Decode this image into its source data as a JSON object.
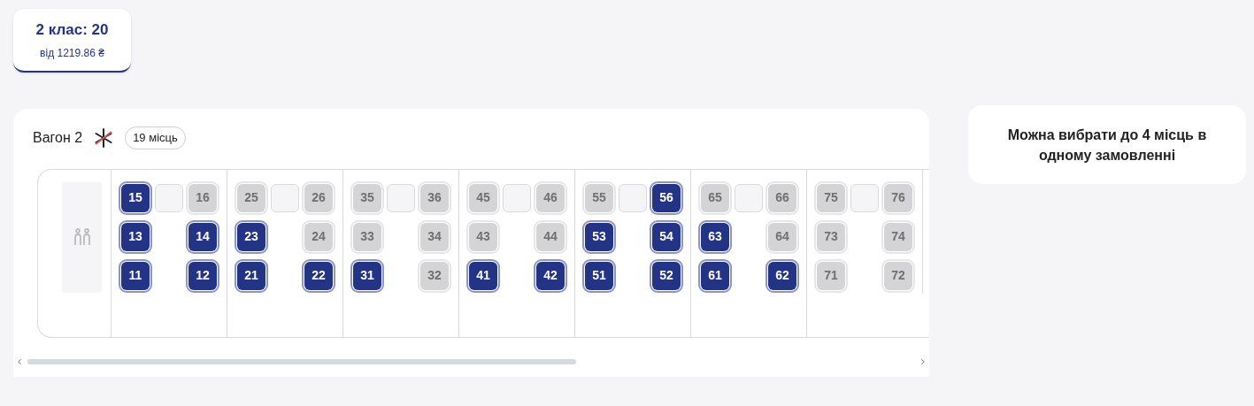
{
  "class_tabs": [
    {
      "title": "2 клас: 20",
      "price": "від 1219.86 ₴",
      "selected": true
    }
  ],
  "wagon": {
    "title": "Вагон 2",
    "seats_badge": "19 місць",
    "compartments": [
      {
        "seats": [
          {
            "number": "15",
            "available": true
          },
          {
            "number": "16",
            "available": false
          },
          {
            "number": "13",
            "available": true
          },
          {
            "number": "14",
            "available": true
          },
          {
            "number": "11",
            "available": true
          },
          {
            "number": "12",
            "available": true
          }
        ]
      },
      {
        "seats": [
          {
            "number": "25",
            "available": false
          },
          {
            "number": "26",
            "available": false
          },
          {
            "number": "23",
            "available": true
          },
          {
            "number": "24",
            "available": false
          },
          {
            "number": "21",
            "available": true
          },
          {
            "number": "22",
            "available": true
          }
        ]
      },
      {
        "seats": [
          {
            "number": "35",
            "available": false
          },
          {
            "number": "36",
            "available": false
          },
          {
            "number": "33",
            "available": false
          },
          {
            "number": "34",
            "available": false
          },
          {
            "number": "31",
            "available": true
          },
          {
            "number": "32",
            "available": false
          }
        ]
      },
      {
        "seats": [
          {
            "number": "45",
            "available": false
          },
          {
            "number": "46",
            "available": false
          },
          {
            "number": "43",
            "available": false
          },
          {
            "number": "44",
            "available": false
          },
          {
            "number": "41",
            "available": true
          },
          {
            "number": "42",
            "available": true
          }
        ]
      },
      {
        "seats": [
          {
            "number": "55",
            "available": false
          },
          {
            "number": "56",
            "available": true
          },
          {
            "number": "53",
            "available": true
          },
          {
            "number": "54",
            "available": true
          },
          {
            "number": "51",
            "available": true
          },
          {
            "number": "52",
            "available": true
          }
        ]
      },
      {
        "seats": [
          {
            "number": "65",
            "available": false
          },
          {
            "number": "66",
            "available": false
          },
          {
            "number": "63",
            "available": true
          },
          {
            "number": "64",
            "available": false
          },
          {
            "number": "61",
            "available": true
          },
          {
            "number": "62",
            "available": true
          }
        ]
      },
      {
        "seats": [
          {
            "number": "75",
            "available": false
          },
          {
            "number": "76",
            "available": false
          },
          {
            "number": "73",
            "available": false
          },
          {
            "number": "74",
            "available": false
          },
          {
            "number": "71",
            "available": false
          },
          {
            "number": "72",
            "available": false
          }
        ]
      }
    ]
  },
  "notice": "Можна вибрати до 4 місць в одному замовленні"
}
